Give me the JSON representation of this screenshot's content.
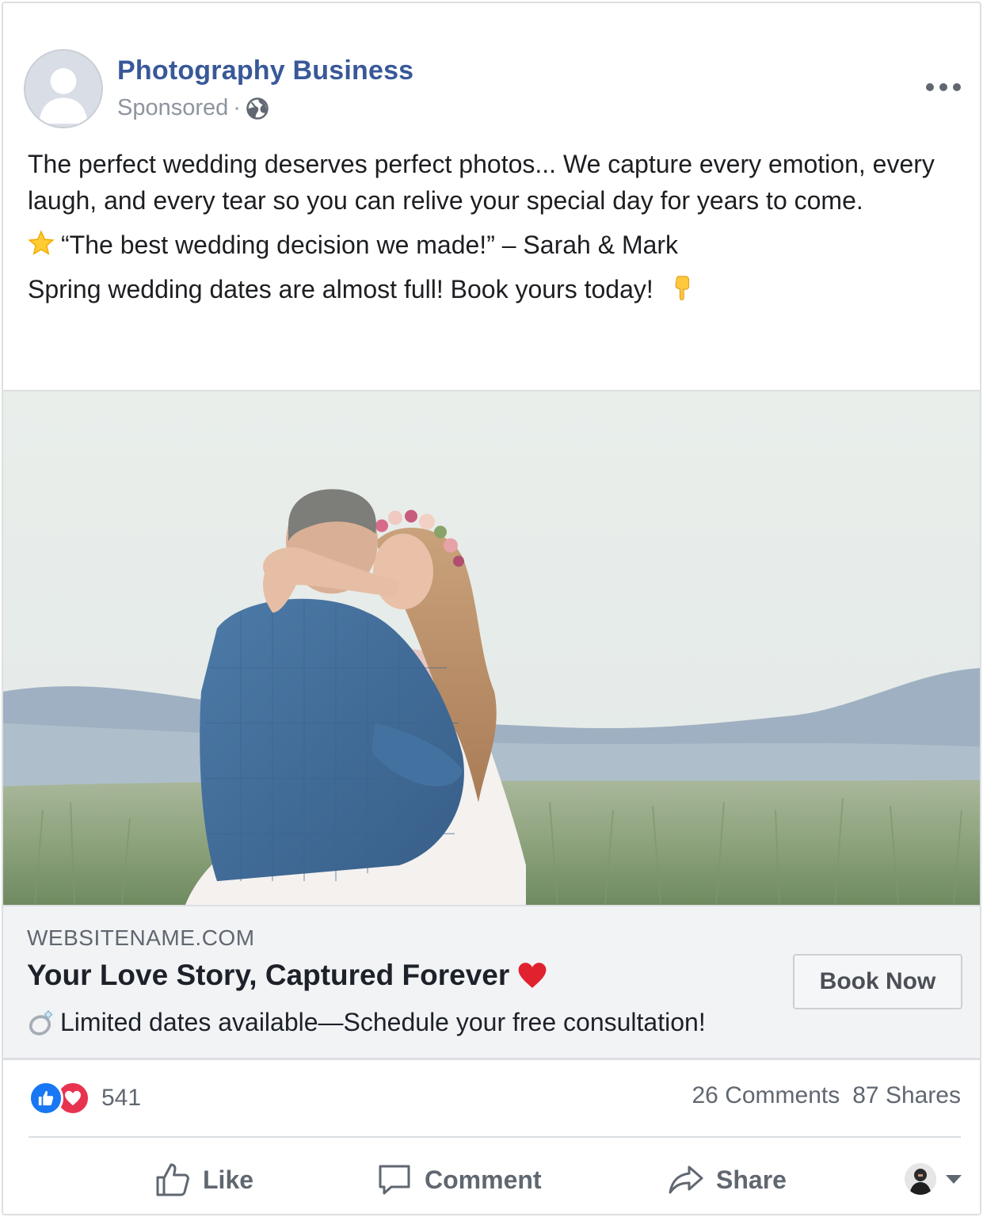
{
  "post": {
    "page_name": "Photography Business",
    "sponsored_label": "Sponsored",
    "separator": "·",
    "body": {
      "line1": "The perfect wedding deserves perfect photos... We capture every emotion, every laugh, and every tear so you can relive your special day for years to come.",
      "line2": "“The best wedding decision we made!” – Sarah & Mark",
      "line3": "Spring wedding dates are almost full! Book yours today!"
    }
  },
  "link_preview": {
    "domain": "WEBSITENAME.COM",
    "headline": "Your Love Story, Captured Forever",
    "description": "Limited dates available—Schedule your free consultation!",
    "cta_label": "Book Now"
  },
  "engagement": {
    "reaction_count": "541",
    "comments": "26 Comments",
    "shares": "87 Shares"
  },
  "actions": {
    "like": "Like",
    "comment": "Comment",
    "share": "Share"
  },
  "colors": {
    "page_name": "#385898",
    "like_blue": "#1877f2",
    "love_red": "#e8334f",
    "muted_text": "#606770"
  }
}
